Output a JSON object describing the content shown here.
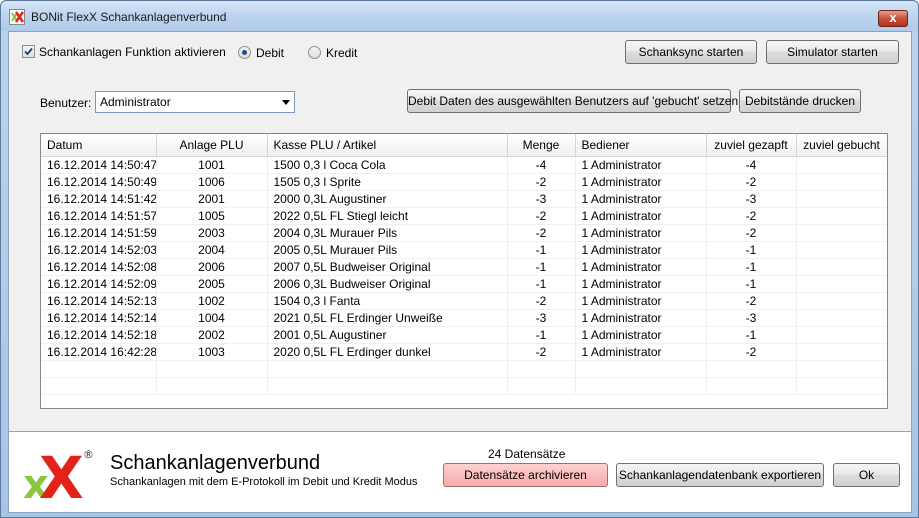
{
  "window": {
    "title": "BONit FlexX Schankanlagenverbund",
    "close_glyph": "x"
  },
  "options": {
    "activate_label": "Schankanlagen Funktion aktivieren",
    "activate_checked": true,
    "mode_debit_label": "Debit",
    "mode_kredit_label": "Kredit",
    "selected_mode": "Debit"
  },
  "toolbar": {
    "sync_label": "Schanksync starten",
    "simulator_label": "Simulator starten",
    "set_booked_label": "Debit Daten des ausgewählten Benutzers auf 'gebucht' setzen",
    "print_label": "Debitstände drucken"
  },
  "user": {
    "label": "Benutzer:",
    "value": "Administrator"
  },
  "table": {
    "columns": [
      "Datum",
      "Anlage PLU",
      "Kasse PLU / Artikel",
      "Menge",
      "Bediener",
      "zuviel gezapft",
      "zuviel gebucht"
    ],
    "rows": [
      [
        "16.12.2014 14:50:47",
        "1001",
        "1500 0,3 l Coca Cola",
        "-4",
        "1 Administrator",
        "-4",
        ""
      ],
      [
        "16.12.2014 14:50:49",
        "1006",
        "1505 0,3 l Sprite",
        "-2",
        "1 Administrator",
        "-2",
        ""
      ],
      [
        "16.12.2014 14:51:42",
        "2001",
        "2000 0,3L Augustiner",
        "-3",
        "1 Administrator",
        "-3",
        ""
      ],
      [
        "16.12.2014 14:51:57",
        "1005",
        "2022 0,5L FL Stiegl leicht",
        "-2",
        "1 Administrator",
        "-2",
        ""
      ],
      [
        "16.12.2014 14:51:59",
        "2003",
        "2004 0,3L Murauer Pils",
        "-2",
        "1 Administrator",
        "-2",
        ""
      ],
      [
        "16.12.2014 14:52:03",
        "2004",
        "2005 0,5L Murauer Pils",
        "-1",
        "1 Administrator",
        "-1",
        ""
      ],
      [
        "16.12.2014 14:52:08",
        "2006",
        "2007 0,5L Budweiser Original",
        "-1",
        "1 Administrator",
        "-1",
        ""
      ],
      [
        "16.12.2014 14:52:09",
        "2005",
        "2006 0,3L Budweiser Original",
        "-1",
        "1 Administrator",
        "-1",
        ""
      ],
      [
        "16.12.2014 14:52:13",
        "1002",
        "1504 0,3 l Fanta",
        "-2",
        "1 Administrator",
        "-2",
        ""
      ],
      [
        "16.12.2014 14:52:14",
        "1004",
        "2021 0,5L FL Erdinger Unweiße",
        "-3",
        "1 Administrator",
        "-3",
        ""
      ],
      [
        "16.12.2014 14:52:18",
        "2002",
        "2001 0,5L Augustiner",
        "-1",
        "1 Administrator",
        "-1",
        ""
      ],
      [
        "16.12.2014 16:42:28",
        "1003",
        "2020 0,5L FL Erdinger dunkel",
        "-2",
        "1 Administrator",
        "-2",
        ""
      ]
    ]
  },
  "footer": {
    "brand_title": "Schankanlagenverbund",
    "brand_subtitle": "Schankanlagen mit dem E-Protokoll im Debit und Kredit Modus",
    "logo_mark": "xX",
    "logo_registered": "®",
    "record_count": "24 Datensätze",
    "archive_label": "Datensätze archivieren",
    "export_label": "Schankanlagendatenbank exportieren",
    "ok_label": "Ok"
  },
  "colors": {
    "logo_green": "#8cc63f",
    "logo_red": "#e2231a",
    "archive_bg": "#f9aaaa"
  }
}
